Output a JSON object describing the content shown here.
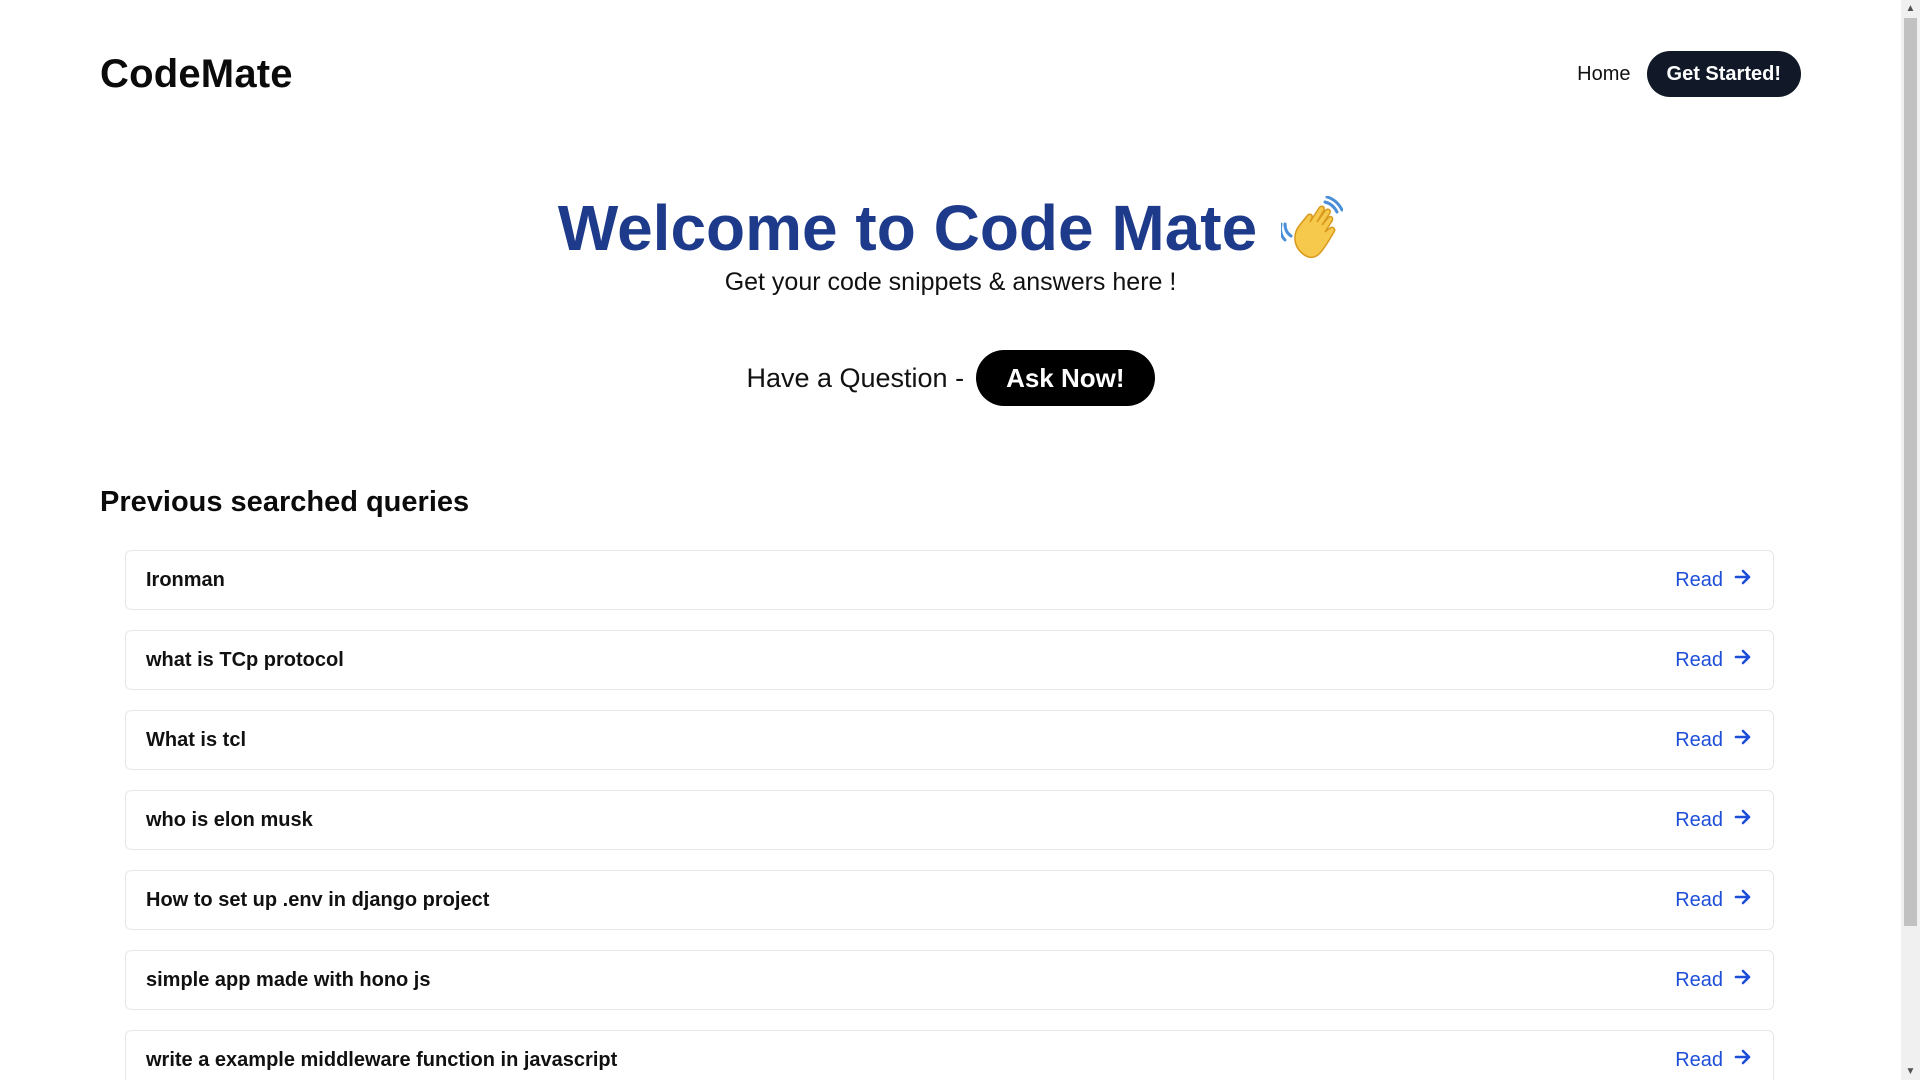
{
  "header": {
    "brand": "CodeMate",
    "nav_home": "Home",
    "get_started": "Get Started!"
  },
  "hero": {
    "title": "Welcome to Code Mate",
    "subtitle": "Get your code snippets & answers here !",
    "ask_prompt": "Have a Question -",
    "ask_button": "Ask Now!"
  },
  "queries": {
    "section_title": "Previous searched queries",
    "read_label": "Read",
    "items": [
      "Ironman",
      "what is TCp protocol",
      "What is tcl",
      "who is elon musk",
      "How to set up .env in django project",
      "simple app made with hono js",
      "write a example middleware function in javascript"
    ]
  },
  "colors": {
    "title_blue": "#1e3a8a",
    "link_blue": "#1d4ed8",
    "dark_button": "#111827"
  },
  "icons": {
    "wave": "waving-hand-icon",
    "read_arrow": "arrow-right-icon"
  }
}
